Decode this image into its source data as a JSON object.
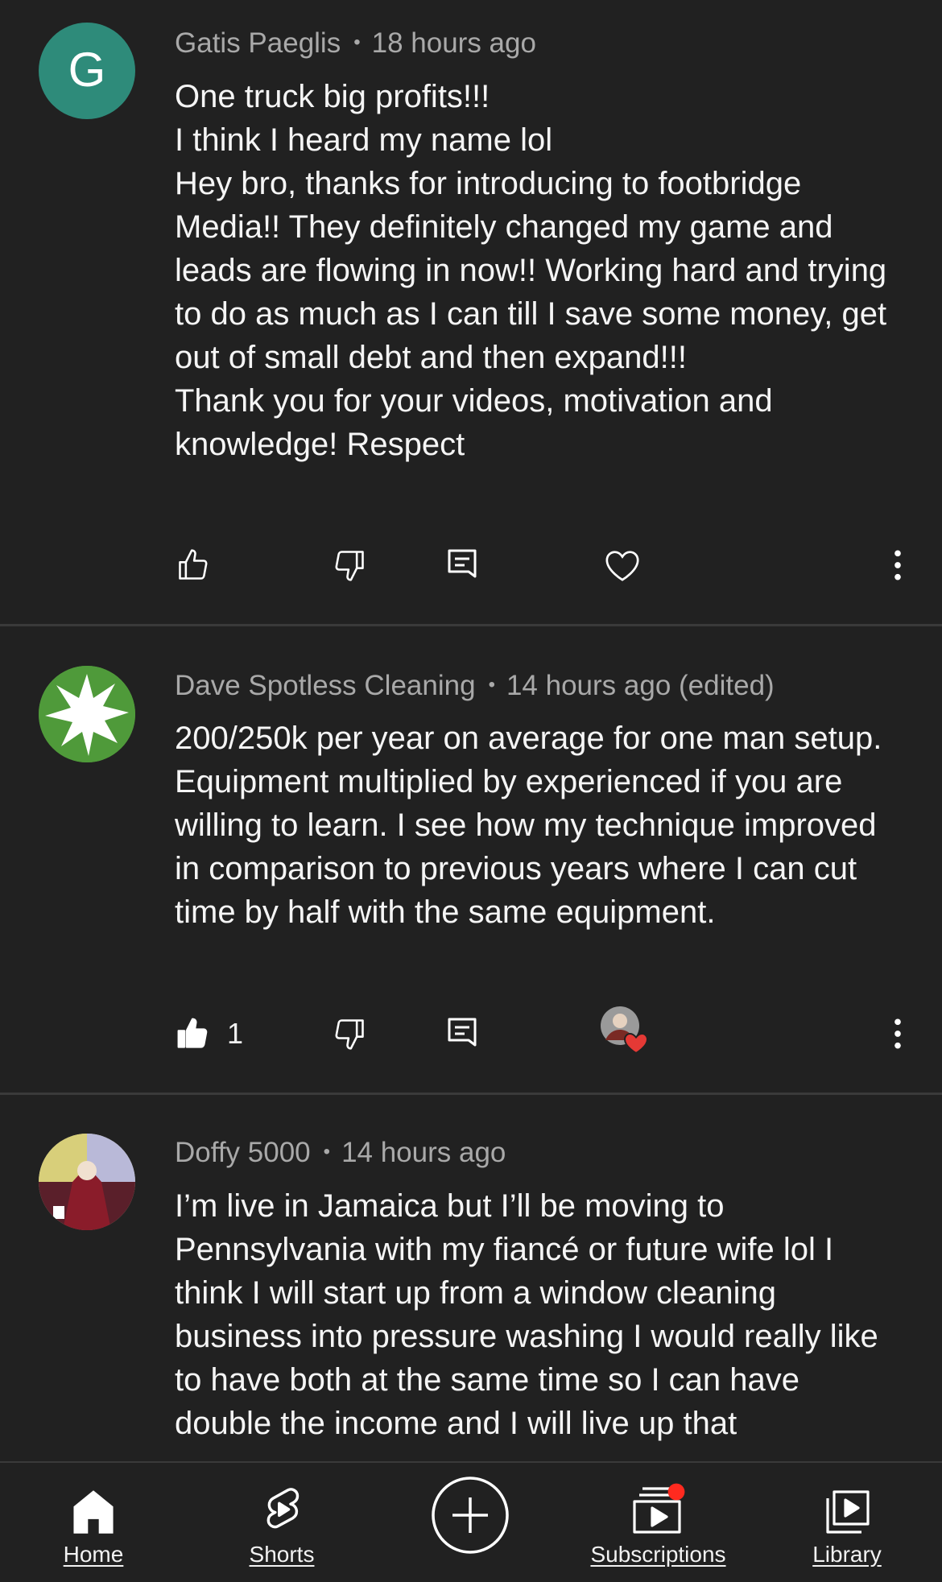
{
  "comments": [
    {
      "author": "Gatis Paeglis",
      "avatar_letter": "G",
      "avatar_color": "#2e8b7a",
      "time": "18 hours ago",
      "lines": [
        "One truck big profits!!!",
        "I think I heard my name lol",
        "Hey bro, thanks for introducing to footbridge Media!! They definitely changed my game and leads are flowing in now!! Working hard and trying to do as much as I can till I save some money, get out of small debt and then expand!!!",
        "Thank you for your videos, motivation and knowledge! Respect"
      ],
      "like_count": "",
      "liked": false,
      "hearted": false
    },
    {
      "author": "Dave Spotless Cleaning",
      "time": "14 hours ago (edited)",
      "lines": [
        "200/250k per year on average for one man setup. Equipment multiplied by experienced if you are willing to learn. I see how my technique improved in comparison to previous years where I can cut time by half with the same equipment."
      ],
      "like_count": "1",
      "liked": true,
      "hearted": true
    },
    {
      "author": "Doffy 5000",
      "time": "14 hours ago",
      "lines": [
        "I’m live in Jamaica but I’ll be moving to Pennsylvania with my fiancé or future wife lol I think I will start up from a window cleaning business into pressure washing I would really like to have both at the same time so I can have double the income and I will live up that"
      ]
    }
  ],
  "icons": {
    "like": "thumb-up-icon",
    "dislike": "thumb-down-icon",
    "reply": "reply-icon",
    "heart": "heart-icon",
    "more": "more-vert-icon"
  },
  "nav": {
    "home": "Home",
    "shorts": "Shorts",
    "create": "",
    "subscriptions": "Subscriptions",
    "library": "Library"
  },
  "colors": {
    "background": "#212121",
    "notification_dot": "#ff2a1f",
    "heart": "#e53935"
  }
}
